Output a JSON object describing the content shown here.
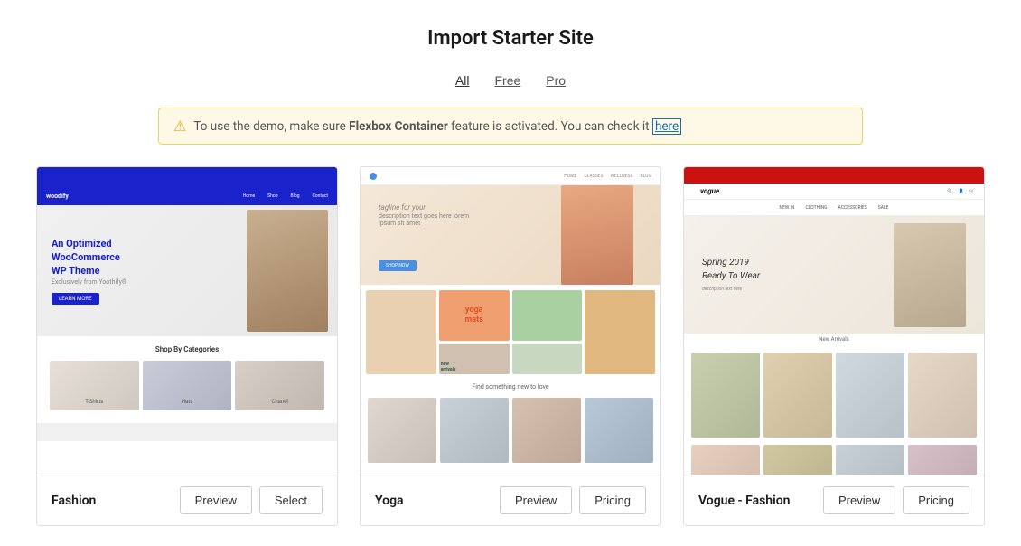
{
  "page": {
    "title": "Import Starter Site"
  },
  "filters": {
    "tabs": [
      {
        "label": "All",
        "active": true
      },
      {
        "label": "Free",
        "active": false
      },
      {
        "label": "Pro",
        "active": false
      }
    ]
  },
  "notice": {
    "text_before": "To use the demo, make sure ",
    "bold_text": "Flexbox Container",
    "text_after": " feature is activated. You can check it ",
    "link_text": "here"
  },
  "cards": [
    {
      "id": "fashion",
      "name": "Fashion",
      "type": "free",
      "actions": [
        {
          "label": "Preview",
          "type": "preview"
        },
        {
          "label": "Select",
          "type": "select"
        }
      ]
    },
    {
      "id": "yoga",
      "name": "Yoga",
      "type": "free",
      "actions": [
        {
          "label": "Preview",
          "type": "preview"
        },
        {
          "label": "Pricing",
          "type": "pricing"
        }
      ]
    },
    {
      "id": "vogue-fashion",
      "name": "Vogue - Fashion",
      "type": "pro",
      "actions": [
        {
          "label": "Preview",
          "type": "preview"
        },
        {
          "label": "Pricing",
          "type": "pricing"
        }
      ]
    }
  ]
}
